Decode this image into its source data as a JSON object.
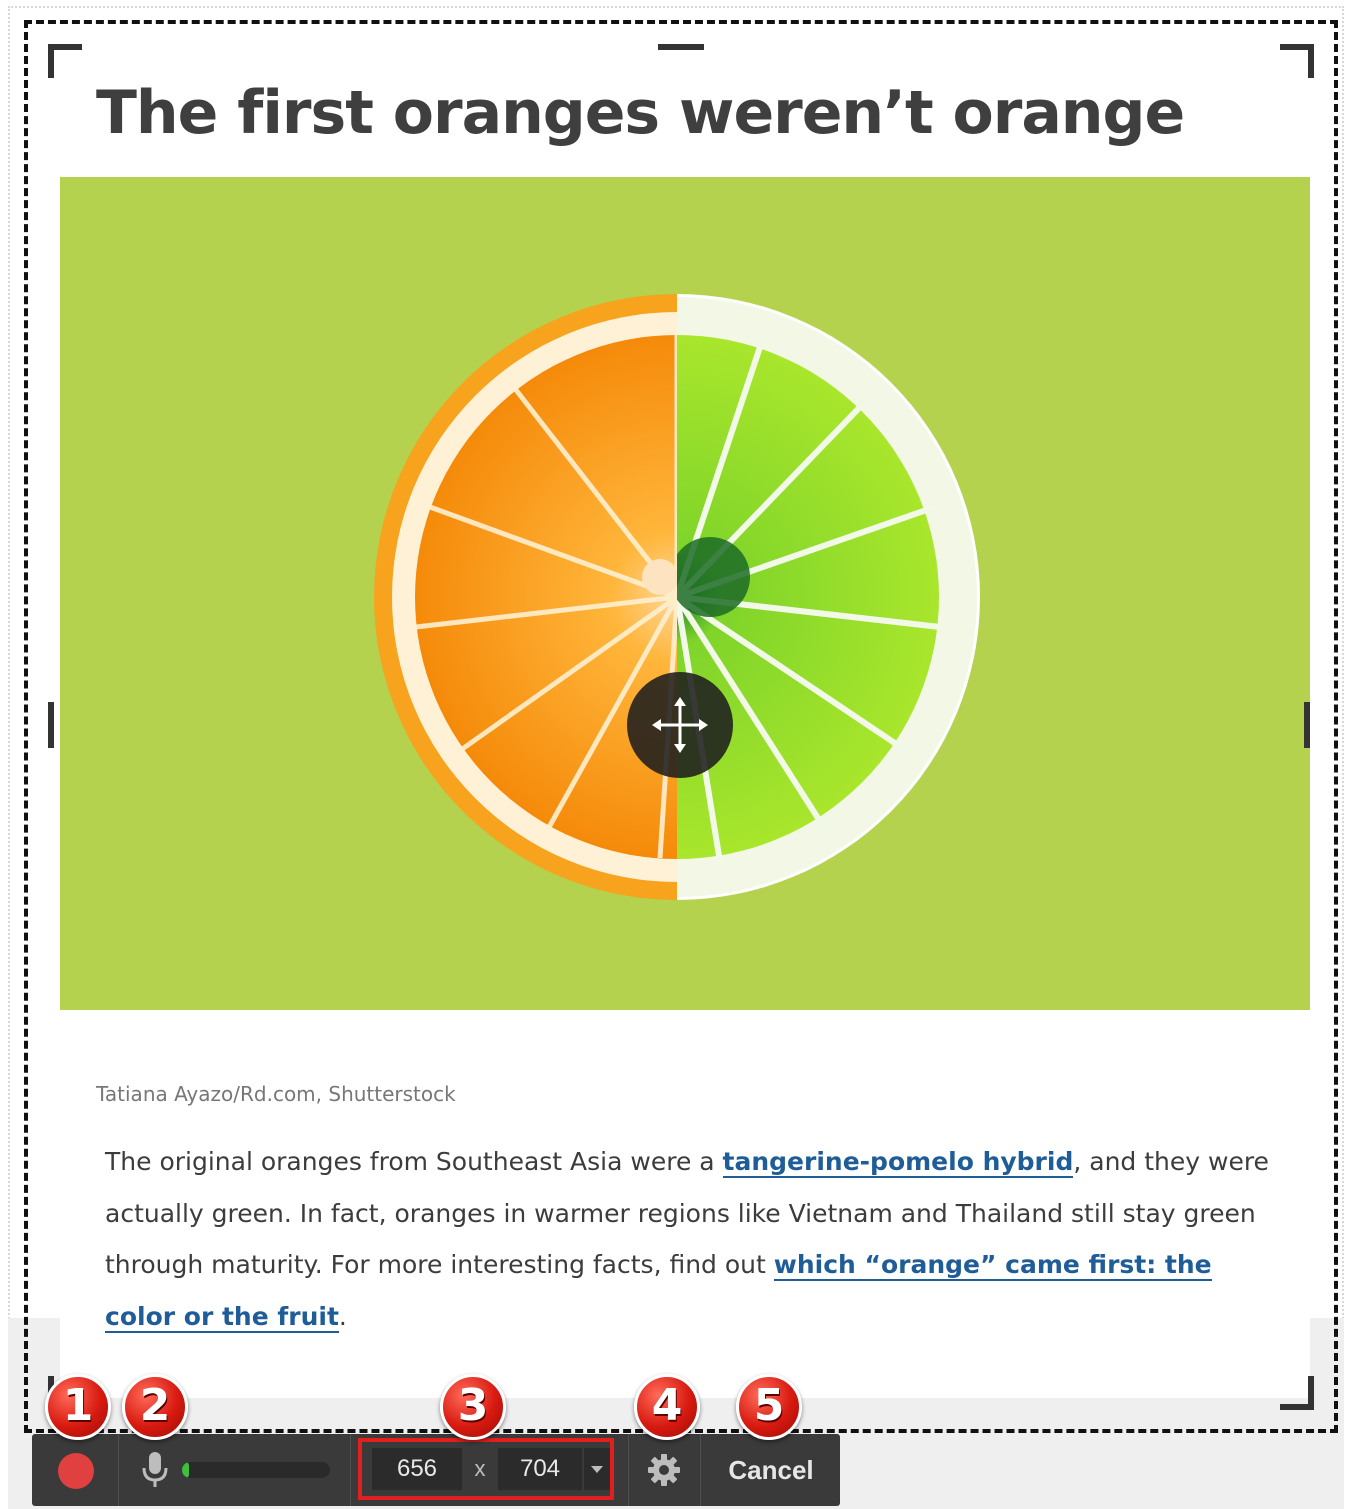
{
  "article": {
    "title": "The first oranges weren’t orange",
    "image_credit": "Tatiana Ayazo/Rd.com, Shutterstock",
    "paragraph": {
      "part1": "The original oranges from Southeast Asia were a ",
      "link1": "tangerine-pomelo hybrid",
      "part2": ", and they were actually green. In fact, oranges in warmer regions like Vietnam and Thailand still stay green through maturity. For more interesting facts, find out ",
      "link2": "which “orange” came first: the color or the fruit",
      "part3": "."
    }
  },
  "hero_image": {
    "description_icon": "orange-lime-half-image",
    "background_color": "#b5d24f"
  },
  "capture": {
    "move_icon": "move-arrows-icon"
  },
  "toolbar": {
    "record_icon": "record-icon",
    "mic_icon": "microphone-icon",
    "mic_level": 0.05,
    "width": "656",
    "times": "x",
    "height": "704",
    "settings_icon": "gear-icon",
    "cancel_label": "Cancel"
  },
  "callouts": [
    "1",
    "2",
    "3",
    "4",
    "5"
  ],
  "colors": {
    "link": "#1f5d98",
    "record": "#e04040",
    "highlight_box": "#e21f1f",
    "toolbar_bg": "#3a3a3a"
  }
}
